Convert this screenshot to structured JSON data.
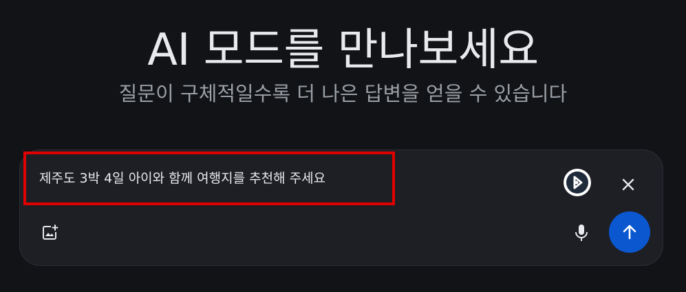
{
  "hero": {
    "title": "AI 모드를 만나보세요",
    "subtitle": "질문이 구체적일수록 더 나은 답변을 얻을 수 있습니다"
  },
  "composer": {
    "query": "제주도 3박 4일 아이와 함께 여행지를 추천해 주세요",
    "highlight_color": "#e00000",
    "icons": {
      "extension": "extension-logo-icon",
      "close": "close-icon",
      "image": "add-image-icon",
      "mic": "microphone-icon",
      "send": "arrow-up-icon"
    },
    "send_button_color": "#0b57d0"
  }
}
